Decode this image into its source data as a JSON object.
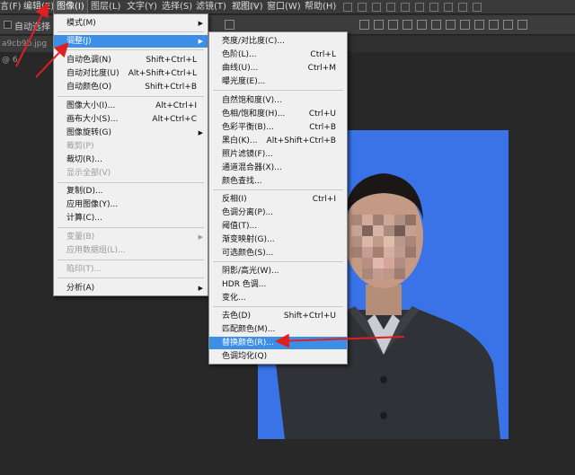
{
  "menubar": {
    "items": [
      "言(F)",
      "编辑(E)",
      "图像(I)",
      "图层(L)",
      "文字(Y)",
      "选择(S)",
      "滤镜(T)",
      "3D(D)",
      "视图(V)",
      "窗口(W)",
      "帮助(H)"
    ]
  },
  "options": {
    "auto_select": "自动选择"
  },
  "doc_tab": {
    "name": "a9cb9b.jpg @ 6"
  },
  "image_menu": {
    "items": [
      {
        "label": "模式(M)",
        "shortcut": "",
        "submenu": true
      },
      {
        "label": "调整(J)",
        "shortcut": "",
        "submenu": true
      },
      {
        "label": "自动色调(N)",
        "shortcut": "Shift+Ctrl+L"
      },
      {
        "label": "自动对比度(U)",
        "shortcut": "Alt+Shift+Ctrl+L"
      },
      {
        "label": "自动颜色(O)",
        "shortcut": "Shift+Ctrl+B"
      },
      {
        "label": "图像大小(I)...",
        "shortcut": "Alt+Ctrl+I"
      },
      {
        "label": "画布大小(S)...",
        "shortcut": "Alt+Ctrl+C"
      },
      {
        "label": "图像旋转(G)",
        "shortcut": "",
        "submenu": true
      },
      {
        "label": "裁剪(P)",
        "shortcut": ""
      },
      {
        "label": "裁切(R)...",
        "shortcut": ""
      },
      {
        "label": "显示全部(V)",
        "shortcut": ""
      },
      {
        "label": "复制(D)...",
        "shortcut": ""
      },
      {
        "label": "应用图像(Y)...",
        "shortcut": ""
      },
      {
        "label": "计算(C)...",
        "shortcut": ""
      },
      {
        "label": "变量(B)",
        "shortcut": "",
        "submenu": true
      },
      {
        "label": "应用数据组(L)...",
        "shortcut": ""
      },
      {
        "label": "陷印(T)...",
        "shortcut": ""
      },
      {
        "label": "分析(A)",
        "shortcut": "",
        "submenu": true
      }
    ]
  },
  "adjust_menu": {
    "items": [
      {
        "label": "亮度/对比度(C)...",
        "shortcut": ""
      },
      {
        "label": "色阶(L)...",
        "shortcut": "Ctrl+L"
      },
      {
        "label": "曲线(U)...",
        "shortcut": "Ctrl+M"
      },
      {
        "label": "曝光度(E)...",
        "shortcut": ""
      },
      {
        "label": "自然饱和度(V)...",
        "shortcut": ""
      },
      {
        "label": "色相/饱和度(H)...",
        "shortcut": "Ctrl+U"
      },
      {
        "label": "色彩平衡(B)...",
        "shortcut": "Ctrl+B"
      },
      {
        "label": "黑白(K)...",
        "shortcut": "Alt+Shift+Ctrl+B"
      },
      {
        "label": "照片滤镜(F)...",
        "shortcut": ""
      },
      {
        "label": "通道混合器(X)...",
        "shortcut": ""
      },
      {
        "label": "颜色查找...",
        "shortcut": ""
      },
      {
        "label": "反相(I)",
        "shortcut": "Ctrl+I"
      },
      {
        "label": "色调分离(P)...",
        "shortcut": ""
      },
      {
        "label": "阈值(T)...",
        "shortcut": ""
      },
      {
        "label": "渐变映射(G)...",
        "shortcut": ""
      },
      {
        "label": "可选颜色(S)...",
        "shortcut": ""
      },
      {
        "label": "阴影/高光(W)...",
        "shortcut": ""
      },
      {
        "label": "HDR 色调...",
        "shortcut": ""
      },
      {
        "label": "变化...",
        "shortcut": ""
      },
      {
        "label": "去色(D)",
        "shortcut": "Shift+Ctrl+U"
      },
      {
        "label": "匹配颜色(M)...",
        "shortcut": ""
      },
      {
        "label": "替换颜色(R)...",
        "shortcut": ""
      },
      {
        "label": "色调均化(Q)",
        "shortcut": ""
      }
    ]
  },
  "colors": {
    "highlight": "#3d8ee6",
    "canvas_bg": "#3a73e8",
    "arrow": "#e02020"
  }
}
